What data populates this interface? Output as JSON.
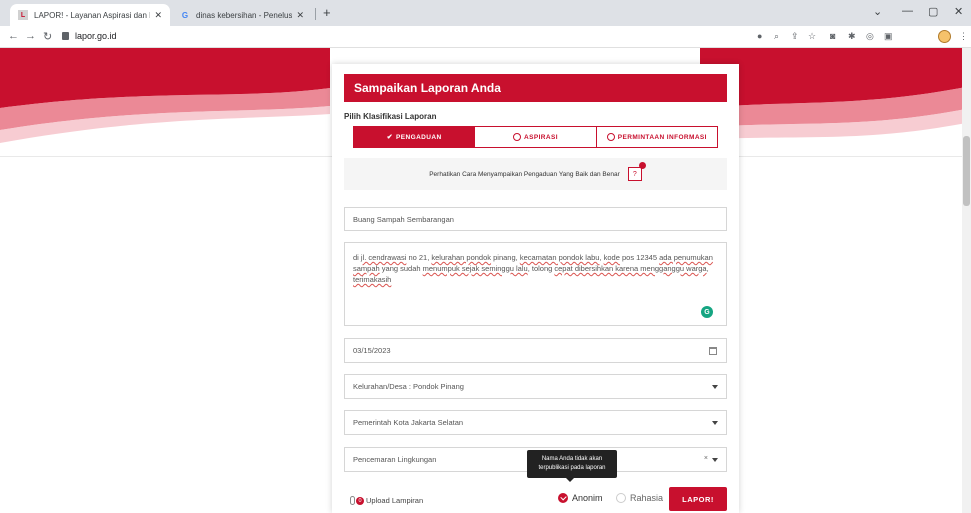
{
  "browser": {
    "tabs": [
      {
        "label": "LAPOR! - Layanan Aspirasi dan P",
        "favicon": "lapor-favicon-icon",
        "active": true
      },
      {
        "label": "dinas kebersihan - Penelusuran G",
        "favicon": "google-icon",
        "active": false
      }
    ],
    "url": "lapor.go.id"
  },
  "form": {
    "header": "Sampaikan Laporan Anda",
    "klasifikasi_label": "Pilih Klasifikasi Laporan",
    "klasifikasi_options": [
      "PENGADUAN",
      "ASPIRASI",
      "PERMINTAAN INFORMASI"
    ],
    "klasifikasi_selected": "PENGADUAN",
    "hint": "Perhatikan Cara Menyampaikan Pengaduan Yang Baik dan Benar",
    "help_label": "?",
    "judul": "Buang Sampah Sembarangan",
    "isi": {
      "p1": "di ",
      "w1": "jl. cendrawasi",
      "p2": " no 21, ",
      "w2": "kelurahan pondok",
      "p3": " pinang, ",
      "w3": "kecamatan pondok labu",
      "p4": ", ",
      "w4": "kode",
      "p5": " pos 12345 ",
      "w5": "ada penumukan sampah",
      "p6": " yang sudah ",
      "w6": "menumpuk sejak seminggu lalu",
      "p7": ", tolong ",
      "w7": "cepat dibersihkan karena mengganggu warga",
      "p8": ", ",
      "w8": "terimakasih"
    },
    "tanggal": "03/15/2023",
    "kelurahan": "Kelurahan/Desa : Pondok Pinang",
    "instansi": "Pemerintah Kota Jakarta Selatan",
    "kategori": "Pencemaran Lingkungan",
    "kategori_clear": "×",
    "upload_label": "Upload Lampiran",
    "upload_count": "0",
    "tooltip_line1": "Nama Anda tidak akan",
    "tooltip_line2": "terpublikasi pada laporan",
    "anonim_label": "Anonim",
    "rahasia_label": "Rahasia",
    "submit_label": "LAPOR!"
  },
  "colors": {
    "accent": "#c8102e",
    "grammarly": "#15a582"
  }
}
